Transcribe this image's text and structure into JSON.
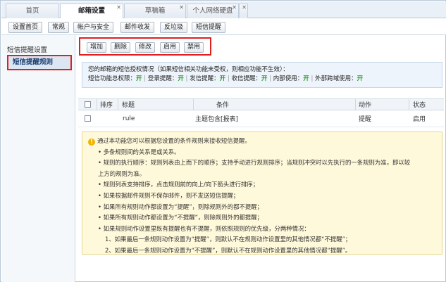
{
  "tabs": [
    {
      "label": "首页"
    },
    {
      "label": "邮箱设置"
    },
    {
      "label": "草稿箱"
    },
    {
      "label": "个人网络硬盘"
    }
  ],
  "toolbar": [
    "设置首页",
    "常规",
    "帐户与安全",
    "邮件收发",
    "反垃圾",
    "短信提醒"
  ],
  "sidebar": {
    "item1": "短信提醒设置",
    "item2": "短信提醒规则"
  },
  "actions": [
    "增加",
    "删除",
    "修改",
    "启用",
    "禁用"
  ],
  "info": {
    "line1": "您的邮箱的短信授权情况（如果短信相关功能未受权，则相应功能不生效）：",
    "labels": [
      "短信功能总权限：",
      "登录提醒：",
      "发信提醒：",
      "收信提醒：",
      "内部使用：",
      "外部跨域使用："
    ],
    "value": "开"
  },
  "table": {
    "headers": {
      "order": "排序",
      "title": "标题",
      "condition": "条件",
      "action": "动作",
      "status": "状态"
    },
    "rows": [
      {
        "title": "rule",
        "condition": "主题包含[报表]",
        "action": "提醒",
        "status": "启用"
      }
    ]
  },
  "help": {
    "lines": [
      "通过本功能您可以根据您设置的条件规则来接收短信提醒。",
      "• 多条规则间的关系是或关系。",
      "• 规则的执行顺序：规则列表由上而下的顺序；支持手动进行规则排序；当规则冲突时以先执行的一条规则为准，即以较",
      "上方的规则为准。",
      "• 规则列表支持排序，点击规则前的向上/向下箭头进行排序；",
      "• 如果根据邮件规则不保存邮件，则不发送短信提醒；",
      "• 如果所有规则动作都设置为“提醒”，则除规则外的都不提醒；",
      "• 如果所有规则动作都设置为“不提醒”，则除规则外的都提醒；",
      "• 如果规则动作设置里既有提醒也有不提醒，则依照规则的优先级，分两种情况：",
      "1、如果最后一条规则动作设置为“提醒”，则默认不在规则动作设置里的其他情况都“不提醒”；",
      "2、如果最后一条规则动作设置为“不提醒”，则默认不在规则动作设置里的其他情况都“提醒”。"
    ]
  },
  "colors": {
    "accent": "#1a3f72",
    "on": "#2a9d2a",
    "highlight": "#e02020",
    "help_bg": "#fff9db"
  }
}
